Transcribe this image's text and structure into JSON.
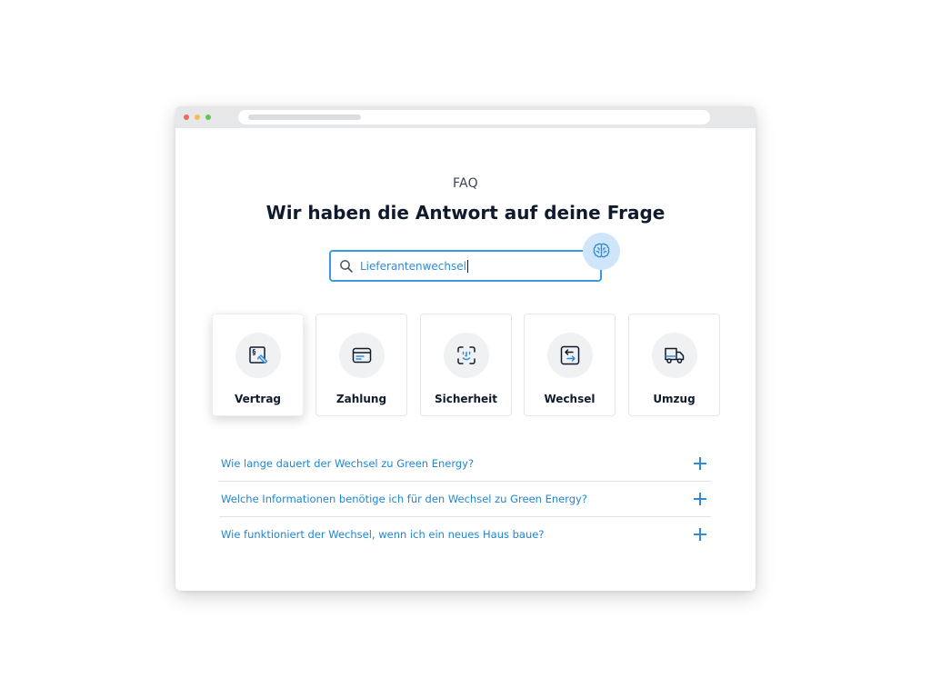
{
  "browser": {
    "dots": [
      "red",
      "yellow",
      "green"
    ],
    "colors": {
      "red": "#ec6a5e",
      "yellow": "#f4bf4f",
      "green": "#61c554"
    }
  },
  "header": {
    "eyebrow": "FAQ",
    "title": "Wir haben die Antwort auf deine Frage"
  },
  "search": {
    "icon": "search-icon",
    "value": "Lieferantenwechsel",
    "assistant_icon": "brain-icon"
  },
  "categories": [
    {
      "label": "Vertrag",
      "icon": "contract-icon",
      "active": true
    },
    {
      "label": "Zahlung",
      "icon": "credit-card-icon",
      "active": false
    },
    {
      "label": "Sicherheit",
      "icon": "face-id-icon",
      "active": false
    },
    {
      "label": "Wechsel",
      "icon": "switch-arrows-icon",
      "active": false
    },
    {
      "label": "Umzug",
      "icon": "moving-truck-icon",
      "active": false
    }
  ],
  "faqs": [
    {
      "question": "Wie lange dauert der Wechsel zu Green Energy?"
    },
    {
      "question": "Welche Informationen benötige ich für den Wechsel zu Green Energy?"
    },
    {
      "question": "Wie funktioniert der Wechsel, wenn ich ein neues Haus baue?"
    }
  ],
  "colors": {
    "accent": "#2f8bd8",
    "text": "#0f1b2d",
    "icon_bg": "#f0f1f3",
    "assistant_bg": "#cfe6fa"
  }
}
